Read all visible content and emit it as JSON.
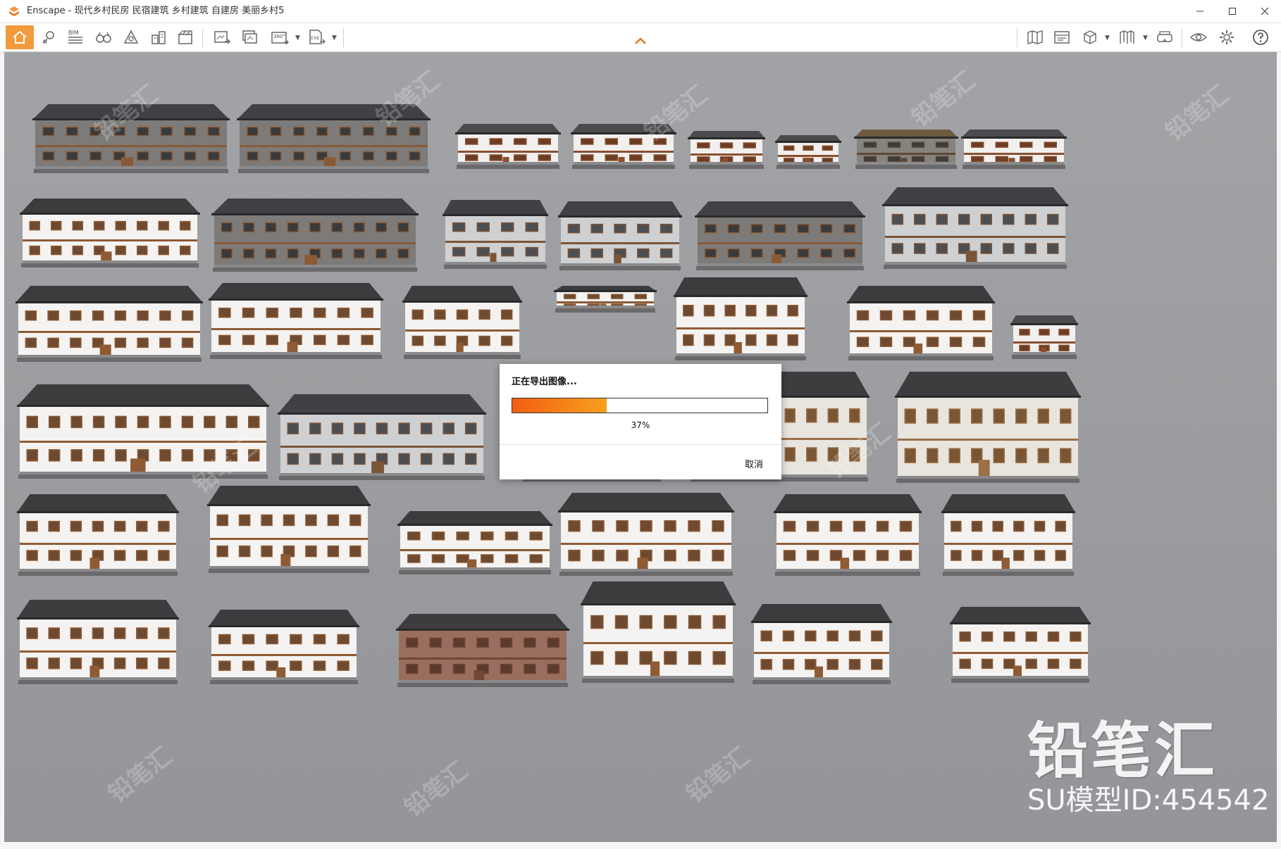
{
  "window": {
    "title": "Enscape - 现代乡村民房 民宿建筑 乡村建筑 自建房 美丽乡村5",
    "minimize_icon": "minimize-icon",
    "maximize_icon": "maximize-icon",
    "close_icon": "close-icon"
  },
  "toolbar": {
    "left_icons": [
      "home-icon",
      "map-pin-icon",
      "bim-icon",
      "binoculars-icon",
      "site-context-icon",
      "asset-library-icon",
      "material-editor-icon",
      "screenshot-icon",
      "batch-render-icon",
      "panorama-360-icon",
      "exe-export-icon"
    ],
    "bim_label": "BIM",
    "panorama_label": "360°",
    "exe_label": "EXE",
    "right_icons": [
      "atlas-icon",
      "video-editor-icon",
      "section-cube-icon",
      "views-icon",
      "vr-headset-icon",
      "visibility-icon",
      "settings-icon",
      "help-icon"
    ]
  },
  "dialog": {
    "title": "正在导出图像...",
    "progress": 0.37,
    "percent_label": "37%",
    "cancel_label": "取消"
  },
  "watermark": {
    "brand": "铅笔汇",
    "model_id": "SU模型ID:454542"
  },
  "colors": {
    "accent": "#f39a3c",
    "progress_start": "#f25d14",
    "progress_end": "#f7a11c",
    "background": "#9d9ea1"
  }
}
